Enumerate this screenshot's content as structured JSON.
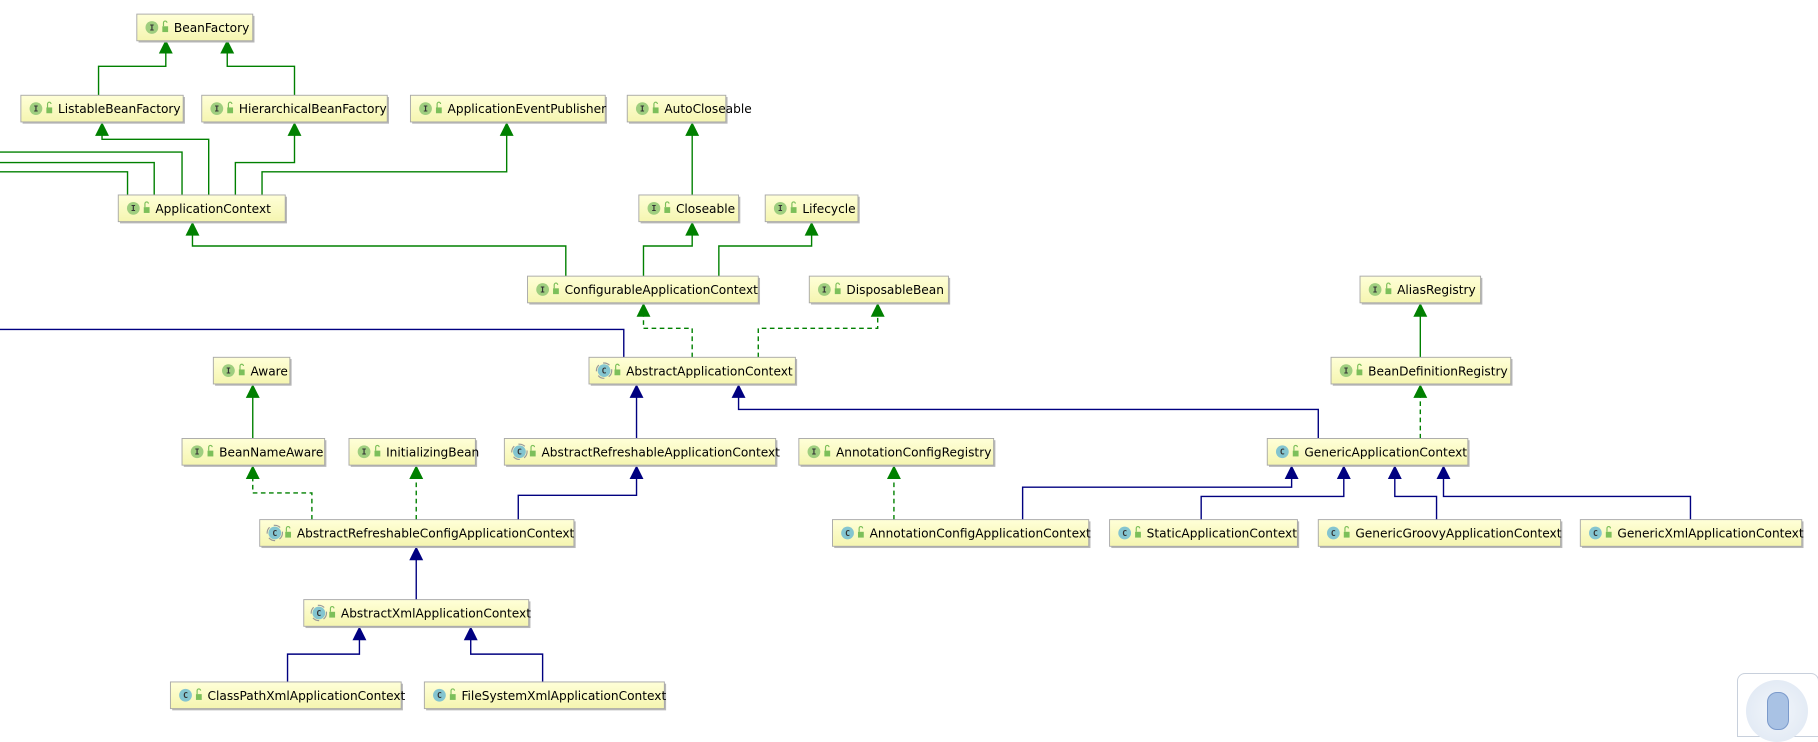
{
  "diagram": {
    "colors": {
      "extends_interface": "#008000",
      "implements": "#008000",
      "extends_class": "#000080",
      "box_fill_top": "#ffffd8",
      "box_fill_bottom": "#f5f5b0",
      "interface_icon": "#9fce7f",
      "class_icon": "#84c5d0",
      "lock_icon": "#7cbf5a"
    },
    "nodes": [
      {
        "label": "BeanFactory",
        "kind": "interface",
        "icon_letter": "I"
      },
      {
        "label": "ListableBeanFactory",
        "kind": "interface",
        "icon_letter": "I"
      },
      {
        "label": "HierarchicalBeanFactory",
        "kind": "interface",
        "icon_letter": "I"
      },
      {
        "label": "ApplicationEventPublisher",
        "kind": "interface",
        "icon_letter": "I"
      },
      {
        "label": "AutoCloseable",
        "kind": "interface",
        "icon_letter": "I"
      },
      {
        "label": "ApplicationContext",
        "kind": "interface",
        "icon_letter": "I"
      },
      {
        "label": "Closeable",
        "kind": "interface",
        "icon_letter": "I"
      },
      {
        "label": "Lifecycle",
        "kind": "interface",
        "icon_letter": "I"
      },
      {
        "label": "ConfigurableApplicationContext",
        "kind": "interface",
        "icon_letter": "I"
      },
      {
        "label": "DisposableBean",
        "kind": "interface",
        "icon_letter": "I"
      },
      {
        "label": "AliasRegistry",
        "kind": "interface",
        "icon_letter": "I"
      },
      {
        "label": "Aware",
        "kind": "interface",
        "icon_letter": "I"
      },
      {
        "label": "AbstractApplicationContext",
        "kind": "abstract-class",
        "icon_letter": "C"
      },
      {
        "label": "BeanDefinitionRegistry",
        "kind": "interface",
        "icon_letter": "I"
      },
      {
        "label": "BeanNameAware",
        "kind": "interface",
        "icon_letter": "I"
      },
      {
        "label": "InitializingBean",
        "kind": "interface",
        "icon_letter": "I"
      },
      {
        "label": "AbstractRefreshableApplicationContext",
        "kind": "abstract-class",
        "icon_letter": "C"
      },
      {
        "label": "AnnotationConfigRegistry",
        "kind": "interface",
        "icon_letter": "I"
      },
      {
        "label": "GenericApplicationContext",
        "kind": "class",
        "icon_letter": "C"
      },
      {
        "label": "AbstractRefreshableConfigApplicationContext",
        "kind": "abstract-class",
        "icon_letter": "C"
      },
      {
        "label": "AnnotationConfigApplicationContext",
        "kind": "class",
        "icon_letter": "C"
      },
      {
        "label": "StaticApplicationContext",
        "kind": "class",
        "icon_letter": "C"
      },
      {
        "label": "GenericGroovyApplicationContext",
        "kind": "class",
        "icon_letter": "C"
      },
      {
        "label": "GenericXmlApplicationContext",
        "kind": "class",
        "icon_letter": "C"
      },
      {
        "label": "AbstractXmlApplicationContext",
        "kind": "abstract-class",
        "icon_letter": "C"
      },
      {
        "label": "ClassPathXmlApplicationContext",
        "kind": "class",
        "icon_letter": "C"
      },
      {
        "label": "FileSystemXmlApplicationContext",
        "kind": "class",
        "icon_letter": "C"
      }
    ],
    "relations": [
      {
        "from": "ListableBeanFactory",
        "to": "BeanFactory",
        "type": "extends_interface"
      },
      {
        "from": "HierarchicalBeanFactory",
        "to": "BeanFactory",
        "type": "extends_interface"
      },
      {
        "from": "ApplicationContext",
        "to": "ListableBeanFactory",
        "type": "extends_interface"
      },
      {
        "from": "ApplicationContext",
        "to": "HierarchicalBeanFactory",
        "type": "extends_interface"
      },
      {
        "from": "ApplicationContext",
        "to": "ApplicationEventPublisher",
        "type": "extends_interface"
      },
      {
        "from": "Closeable",
        "to": "AutoCloseable",
        "type": "extends_interface"
      },
      {
        "from": "ConfigurableApplicationContext",
        "to": "ApplicationContext",
        "type": "extends_interface"
      },
      {
        "from": "ConfigurableApplicationContext",
        "to": "Closeable",
        "type": "extends_interface"
      },
      {
        "from": "ConfigurableApplicationContext",
        "to": "Lifecycle",
        "type": "extends_interface"
      },
      {
        "from": "BeanDefinitionRegistry",
        "to": "AliasRegistry",
        "type": "extends_interface"
      },
      {
        "from": "BeanNameAware",
        "to": "Aware",
        "type": "extends_interface"
      },
      {
        "from": "AbstractApplicationContext",
        "to": "ConfigurableApplicationContext",
        "type": "implements"
      },
      {
        "from": "AbstractApplicationContext",
        "to": "DisposableBean",
        "type": "implements"
      },
      {
        "from": "GenericApplicationContext",
        "to": "BeanDefinitionRegistry",
        "type": "implements"
      },
      {
        "from": "AbstractRefreshableConfigApplicationContext",
        "to": "BeanNameAware",
        "type": "implements"
      },
      {
        "from": "AbstractRefreshableConfigApplicationContext",
        "to": "InitializingBean",
        "type": "implements"
      },
      {
        "from": "AnnotationConfigApplicationContext",
        "to": "AnnotationConfigRegistry",
        "type": "implements"
      },
      {
        "from": "AbstractRefreshableApplicationContext",
        "to": "AbstractApplicationContext",
        "type": "extends_class"
      },
      {
        "from": "GenericApplicationContext",
        "to": "AbstractApplicationContext",
        "type": "extends_class"
      },
      {
        "from": "AbstractRefreshableConfigApplicationContext",
        "to": "AbstractRefreshableApplicationContext",
        "type": "extends_class"
      },
      {
        "from": "AnnotationConfigApplicationContext",
        "to": "GenericApplicationContext",
        "type": "extends_class"
      },
      {
        "from": "StaticApplicationContext",
        "to": "GenericApplicationContext",
        "type": "extends_class"
      },
      {
        "from": "GenericGroovyApplicationContext",
        "to": "GenericApplicationContext",
        "type": "extends_class"
      },
      {
        "from": "GenericXmlApplicationContext",
        "to": "GenericApplicationContext",
        "type": "extends_class"
      },
      {
        "from": "AbstractXmlApplicationContext",
        "to": "AbstractRefreshableConfigApplicationContext",
        "type": "extends_class"
      },
      {
        "from": "ClassPathXmlApplicationContext",
        "to": "AbstractXmlApplicationContext",
        "type": "extends_class"
      },
      {
        "from": "FileSystemXmlApplicationContext",
        "to": "AbstractXmlApplicationContext",
        "type": "extends_class"
      }
    ]
  },
  "widget": {
    "icon": "microphone-icon"
  }
}
